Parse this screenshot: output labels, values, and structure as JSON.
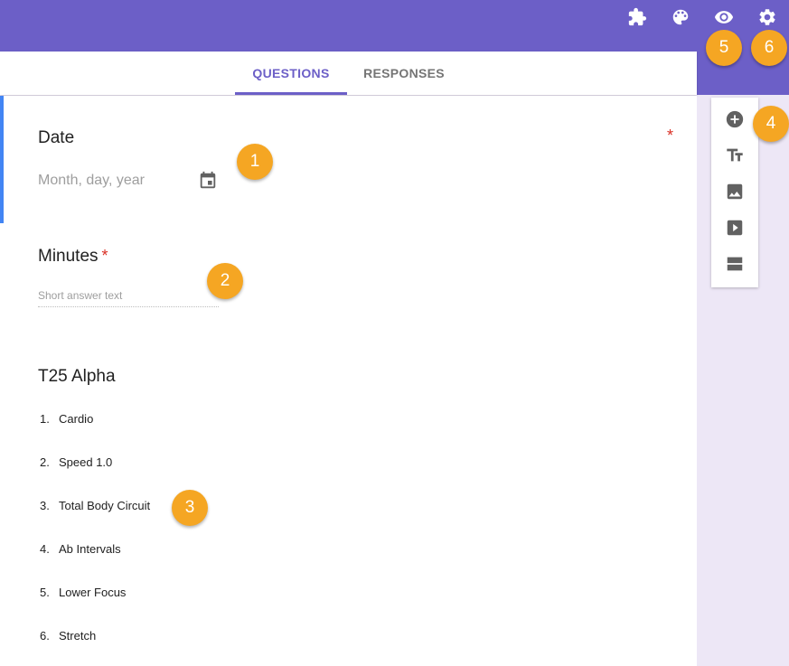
{
  "colors": {
    "brand": "#6c5fc7",
    "accent_left": "#4285f4",
    "required": "#d93025",
    "badge": "#f5a623"
  },
  "topbar": {
    "icons": [
      "puzzle-icon",
      "palette-icon",
      "eye-icon",
      "gear-icon"
    ]
  },
  "tabs": [
    {
      "label": "QUESTIONS",
      "active": true
    },
    {
      "label": "RESPONSES",
      "active": false
    }
  ],
  "questions": {
    "date": {
      "title": "Date",
      "required_mark": "*",
      "placeholder": "Month, day, year"
    },
    "minutes": {
      "title": "Minutes",
      "required_mark": "*",
      "placeholder": "Short answer text"
    },
    "section": {
      "title": "T25 Alpha"
    }
  },
  "list": [
    {
      "num": "1.",
      "text": "Cardio"
    },
    {
      "num": "2.",
      "text": "Speed 1.0"
    },
    {
      "num": "3.",
      "text": "Total Body Circuit"
    },
    {
      "num": "4.",
      "text": "Ab Intervals"
    },
    {
      "num": "5.",
      "text": "Lower Focus"
    },
    {
      "num": "6.",
      "text": "Stretch"
    }
  ],
  "toolbox": {
    "tools": [
      "add-question-icon",
      "add-title-icon",
      "add-image-icon",
      "add-video-icon",
      "add-section-icon"
    ]
  },
  "badges": [
    "1",
    "2",
    "3",
    "4",
    "5",
    "6"
  ]
}
